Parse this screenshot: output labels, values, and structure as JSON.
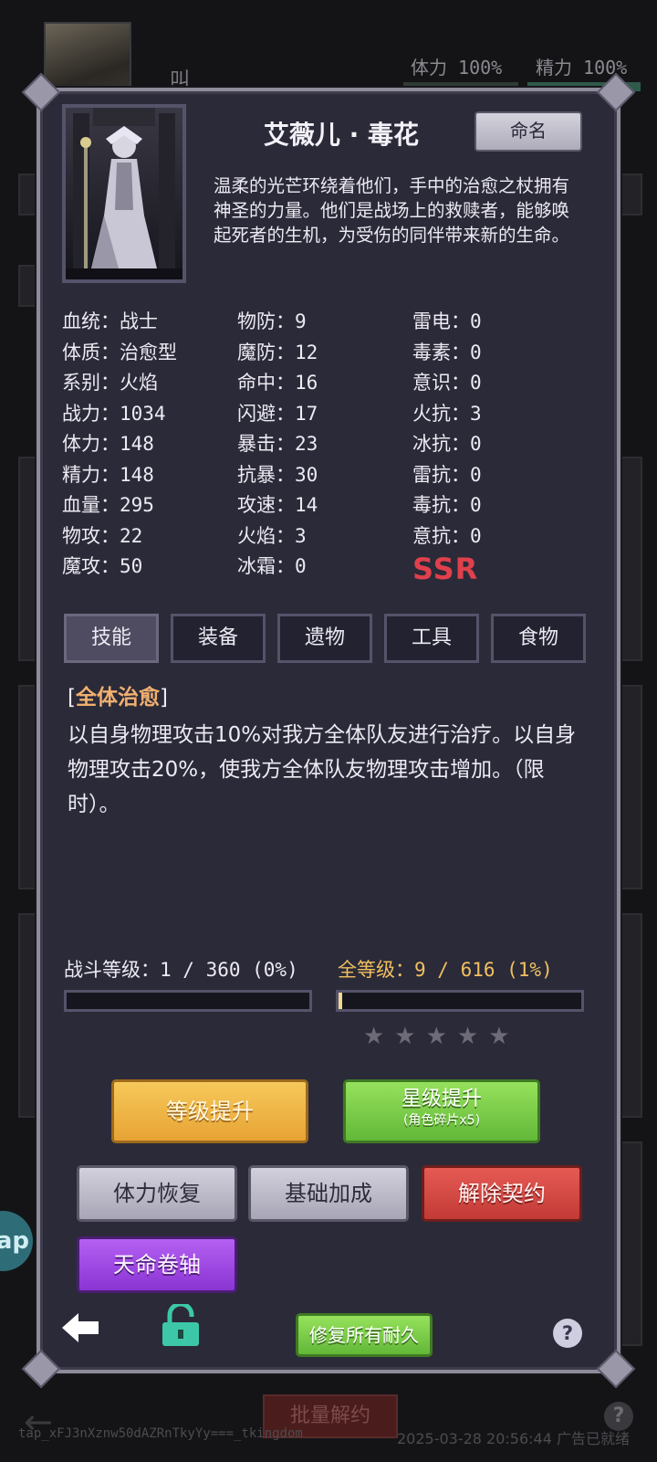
{
  "background": {
    "player_name_fragment": "叫",
    "stamina_label": "体力 100%",
    "energy_label": "精力 100%",
    "batch_release_label": "批量解约",
    "footer_left": "tap_xFJ3nXznw50dAZRnTkyYy===_tkingdom",
    "footer_right": "2025-03-28 20:56:44 广告已就绪",
    "floating_label": "ap",
    "help_glyph": "?"
  },
  "character": {
    "name": "艾薇儿 · 毒花",
    "rename_label": "命名",
    "description": "温柔的光芒环绕着他们，手中的治愈之杖拥有神圣的力量。他们是战场上的救赎者，能够唤起死者的生机，为受伤的同伴带来新的生命。",
    "rarity": "SSR",
    "rarity_color": "#e0404c"
  },
  "stats": {
    "col1": [
      {
        "key": "血统",
        "value": "战士"
      },
      {
        "key": "体质",
        "value": "治愈型"
      },
      {
        "key": "系别",
        "value": "火焰"
      },
      {
        "key": "战力",
        "value": "1034"
      },
      {
        "key": "体力",
        "value": "148"
      },
      {
        "key": "精力",
        "value": "148"
      },
      {
        "key": "血量",
        "value": "295"
      },
      {
        "key": "物攻",
        "value": "22"
      },
      {
        "key": "魔攻",
        "value": "50"
      }
    ],
    "col2": [
      {
        "key": "物防",
        "value": "9"
      },
      {
        "key": "魔防",
        "value": "12"
      },
      {
        "key": "命中",
        "value": "16"
      },
      {
        "key": "闪避",
        "value": "17"
      },
      {
        "key": "暴击",
        "value": "23"
      },
      {
        "key": "抗暴",
        "value": "30"
      },
      {
        "key": "攻速",
        "value": "14"
      },
      {
        "key": "火焰",
        "value": "3"
      },
      {
        "key": "冰霜",
        "value": "0"
      }
    ],
    "col3": [
      {
        "key": "雷电",
        "value": "0"
      },
      {
        "key": "毒素",
        "value": "0"
      },
      {
        "key": "意识",
        "value": "0"
      },
      {
        "key": "火抗",
        "value": "3"
      },
      {
        "key": "冰抗",
        "value": "0"
      },
      {
        "key": "雷抗",
        "value": "0"
      },
      {
        "key": "毒抗",
        "value": "0"
      },
      {
        "key": "意抗",
        "value": "0"
      }
    ]
  },
  "tabs": [
    "技能",
    "装备",
    "遗物",
    "工具",
    "食物"
  ],
  "active_tab": 0,
  "skill": {
    "bracket_open": "[",
    "name": "全体治愈",
    "bracket_close": "]",
    "description": "以自身物理攻击10%对我方全体队友进行治疗。以自身物理攻击20%，使我方全体队友物理攻击增加。（限时）。"
  },
  "levels": {
    "battle_label": "战斗等级：",
    "battle_value": "1 / 360 (0%)",
    "battle_progress": 0.0,
    "total_label": "全等级：",
    "total_value": "9 / 616 (1%)",
    "total_progress": 0.015
  },
  "stars": {
    "filled": 0,
    "total": 5,
    "glyphs": "★★★★★"
  },
  "buttons": {
    "level_up": "等级提升",
    "star_up": "星级提升",
    "star_up_sub": "(角色碎片x5)",
    "stamina_restore": "体力恢复",
    "base_bonus": "基础加成",
    "release_contract": "解除契约",
    "fate_scroll": "天命卷轴",
    "repair_all": "修复所有耐久",
    "help": "?"
  },
  "colors": {
    "panel_bg": "#2b2a38",
    "gold": "#f0c060",
    "skill_highlight": "#f0b070",
    "lock_icon": "#3cc8a8"
  }
}
